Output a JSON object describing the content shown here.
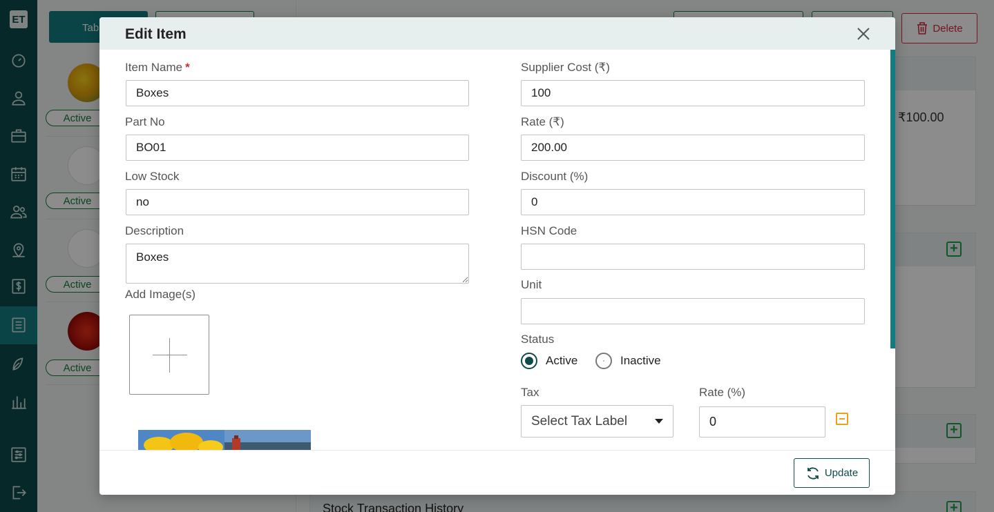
{
  "app": {
    "logo": "ET"
  },
  "sidebar": {
    "icons": [
      "dashboard-icon",
      "user-icon",
      "briefcase-icon",
      "calendar-icon",
      "users-icon",
      "map-pin-icon",
      "dollar-icon",
      "list-icon",
      "leaf-icon",
      "chart-icon",
      "settings-icon",
      "logout-icon"
    ],
    "active_index": 7,
    "active_color": "#137c82"
  },
  "background": {
    "toolbar_label": "Tab",
    "delete_label": "Delete",
    "price": "₹100.00",
    "history_title": "Stock Transaction History",
    "cards": [
      {
        "status": "Active"
      },
      {
        "status": "Active"
      },
      {
        "status": "Active"
      },
      {
        "status": "Active"
      }
    ]
  },
  "modal": {
    "title": "Edit Item",
    "update_label": "Update",
    "fields": {
      "item_name": {
        "label": "Item Name",
        "required_mark": "*",
        "value": "Boxes"
      },
      "part_no": {
        "label": "Part No",
        "value": "BO01"
      },
      "low_stock": {
        "label": "Low Stock",
        "value": "no"
      },
      "description": {
        "label": "Description",
        "value": "Boxes"
      },
      "add_images": {
        "label": "Add Image(s)"
      },
      "supplier_cost": {
        "label": "Supplier Cost (₹)",
        "value": "100"
      },
      "rate": {
        "label": "Rate (₹)",
        "value": "200.00"
      },
      "discount": {
        "label": "Discount (%)",
        "value": "0"
      },
      "hsn_code": {
        "label": "HSN Code",
        "value": ""
      },
      "unit": {
        "label": "Unit",
        "value": ""
      },
      "status": {
        "label": "Status",
        "options": [
          "Active",
          "Inactive"
        ],
        "selected": "Active"
      },
      "tax": {
        "label": "Tax",
        "placeholder": "Select Tax Label"
      },
      "tax_rate": {
        "label": "Rate (%)",
        "value": "0"
      }
    }
  },
  "colors": {
    "primary": "#0d4a49",
    "accent": "#137c82",
    "danger": "#cf2a3a",
    "success": "#1f9d4a",
    "warning": "#e8a21a"
  }
}
